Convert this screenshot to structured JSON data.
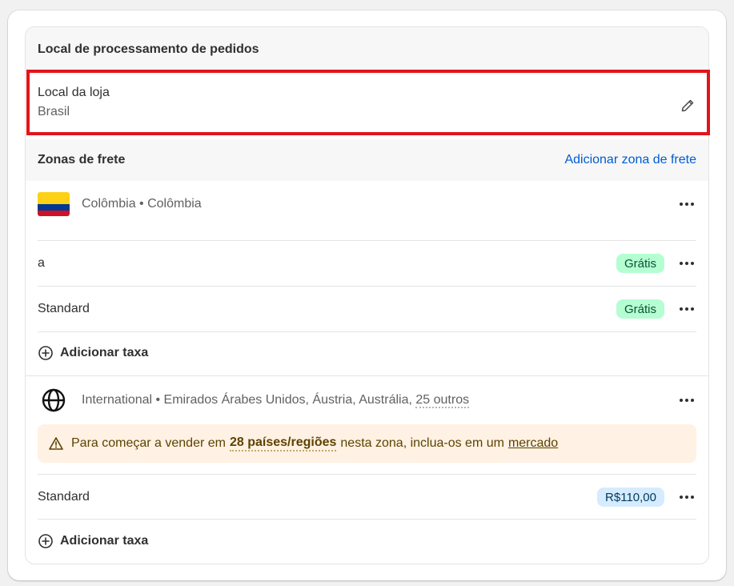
{
  "processing": {
    "header": "Local de processamento de pedidos",
    "store_location_title": "Local da loja",
    "store_location_value": "Brasil"
  },
  "zones": {
    "header": "Zonas de frete",
    "add_zone_link": "Adicionar zona de frete",
    "colombia": {
      "title": "Colômbia • Colômbia",
      "rates": [
        {
          "name": "a",
          "price": "Grátis"
        },
        {
          "name": "Standard",
          "price": "Grátis"
        }
      ],
      "add_rate": "Adicionar taxa"
    },
    "international": {
      "title_prefix": "International • Emirados Árabes Unidos, Áustria, Austrália,",
      "others": "25 outros",
      "warning": {
        "prefix": "Para começar a vender em",
        "bold": "28 países/regiões",
        "middle": "nesta zona, inclua-os em um",
        "link": "mercado"
      },
      "rates": [
        {
          "name": "Standard",
          "price": "R$110,00"
        }
      ],
      "add_rate": "Adicionar taxa"
    }
  },
  "colors": {
    "highlight": "#e3141b",
    "link": "#005bd3",
    "badge_green": "#b4fed2",
    "badge_blue": "#d5ebff",
    "warning_bg": "#fff1e3"
  },
  "icons": [
    "pencil-icon",
    "colombia-flag-icon",
    "globe-icon",
    "more-options-icon",
    "plus-circle-icon",
    "warning-icon"
  ]
}
